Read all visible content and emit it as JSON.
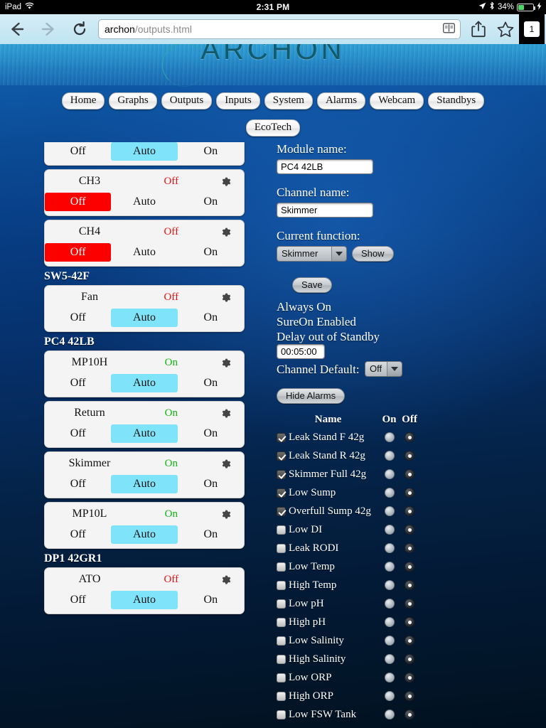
{
  "statusbar": {
    "device": "iPad",
    "wifi_icon": "wifi-icon",
    "time": "2:31 PM",
    "location_icon": "location-arrow-icon",
    "bluetooth_icon": "bluetooth-icon",
    "battery_percent": "34%",
    "charging_icon": "lightning-bolt-icon"
  },
  "browser": {
    "back_icon": "back-arrow-icon",
    "forward_icon": "forward-arrow-icon",
    "reload_icon": "reload-icon",
    "url_host": "archon",
    "url_path": "/outputs.html",
    "reader_icon": "reader-view-icon",
    "share_icon": "share-icon",
    "bookmark_icon": "bookmark-star-icon",
    "tab_count": "1"
  },
  "site": {
    "logo_text": "ARCHON",
    "nav_primary": [
      "Home",
      "Graphs",
      "Outputs",
      "Inputs",
      "System",
      "Alarms",
      "Webcam",
      "Standbys"
    ],
    "nav_secondary": [
      "EcoTech"
    ],
    "segment_labels": {
      "off": "Off",
      "auto": "Auto",
      "on": "On"
    },
    "gear_icon": "gear-icon"
  },
  "channels": [
    {
      "group": null,
      "clipped": true,
      "name": "",
      "state": "",
      "state_class": "",
      "selected": "auto",
      "show_top": false
    },
    {
      "group": null,
      "clipped": false,
      "name": "CH3",
      "state": "Off",
      "state_class": "off",
      "selected": "off",
      "show_top": true
    },
    {
      "group": null,
      "clipped": false,
      "name": "CH4",
      "state": "Off",
      "state_class": "off",
      "selected": "off",
      "show_top": true
    },
    {
      "group": "SW5-42F",
      "clipped": false,
      "name": "Fan",
      "state": "Off",
      "state_class": "off",
      "selected": "auto",
      "show_top": true
    },
    {
      "group": "PC4 42LB",
      "clipped": false,
      "name": "MP10H",
      "state": "On",
      "state_class": "on",
      "selected": "auto",
      "show_top": true
    },
    {
      "group": null,
      "clipped": false,
      "name": "Return",
      "state": "On",
      "state_class": "on",
      "selected": "auto",
      "show_top": true
    },
    {
      "group": null,
      "clipped": false,
      "name": "Skimmer",
      "state": "On",
      "state_class": "on",
      "selected": "auto",
      "show_top": true
    },
    {
      "group": null,
      "clipped": false,
      "name": "MP10L",
      "state": "On",
      "state_class": "on",
      "selected": "auto",
      "show_top": true
    },
    {
      "group": "DP1 42GR1",
      "clipped": false,
      "name": "ATO",
      "state": "Off",
      "state_class": "off",
      "selected": "auto",
      "show_top": true
    }
  ],
  "form": {
    "module_name_label": "Module name:",
    "module_name_value": "PC4 42LB",
    "channel_name_label": "Channel name:",
    "channel_name_value": "Skimmer",
    "current_function_label": "Current function:",
    "current_function_value": "Skimmer",
    "show_button": "Show",
    "save_button": "Save",
    "always_on": "Always On",
    "sure_on": "SureOn Enabled",
    "delay_label": "Delay out of Standby",
    "delay_value": "00:05:00",
    "channel_default_label": "Channel Default:",
    "channel_default_value": "Off",
    "hide_alarms_button": "Hide Alarms"
  },
  "alarms": {
    "header": {
      "name": "Name",
      "on": "On",
      "off": "Off"
    },
    "rows": [
      {
        "label": "Leak Stand F 42g",
        "checked": true,
        "selected": "off"
      },
      {
        "label": "Leak Stand R 42g",
        "checked": true,
        "selected": "off"
      },
      {
        "label": "Skimmer Full 42g",
        "checked": true,
        "selected": "off"
      },
      {
        "label": "Low Sump",
        "checked": true,
        "selected": "off"
      },
      {
        "label": "Overfull Sump 42g",
        "checked": true,
        "selected": "off"
      },
      {
        "label": "Low DI",
        "checked": false,
        "selected": "off"
      },
      {
        "label": "Leak RODI",
        "checked": false,
        "selected": "off"
      },
      {
        "label": "Low Temp",
        "checked": false,
        "selected": "off"
      },
      {
        "label": "High Temp",
        "checked": false,
        "selected": "off"
      },
      {
        "label": "Low pH",
        "checked": false,
        "selected": "off"
      },
      {
        "label": "High pH",
        "checked": false,
        "selected": "off"
      },
      {
        "label": "Low Salinity",
        "checked": false,
        "selected": "off"
      },
      {
        "label": "High Salinity",
        "checked": false,
        "selected": "off"
      },
      {
        "label": "Low ORP",
        "checked": false,
        "selected": "off"
      },
      {
        "label": "High ORP",
        "checked": false,
        "selected": "off"
      },
      {
        "label": "Low FSW Tank",
        "checked": false,
        "selected": "off"
      }
    ]
  },
  "colors": {
    "auto_selected": "#7fe3fa",
    "off_selected": "#fc0000",
    "state_on": "#11b511",
    "state_off": "#e81111",
    "page_bg_top": "#1566b4",
    "page_bg_bottom": "#01101f"
  }
}
